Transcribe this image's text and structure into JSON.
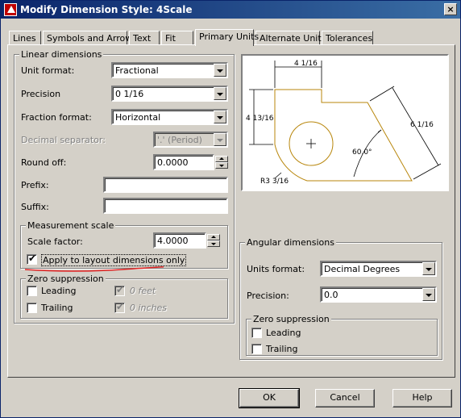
{
  "window": {
    "title": "Modify Dimension Style: 4Scale",
    "close_label": "×"
  },
  "tabs": [
    {
      "label": "Lines"
    },
    {
      "label": "Symbols and Arrows"
    },
    {
      "label": "Text"
    },
    {
      "label": "Fit"
    },
    {
      "label": "Primary Units"
    },
    {
      "label": "Alternate Units"
    },
    {
      "label": "Tolerances"
    }
  ],
  "active_tab": "Primary Units",
  "linear": {
    "group_title": "Linear dimensions",
    "unit_format_label": "Unit format:",
    "unit_format_value": "Fractional",
    "precision_label": "Precision",
    "precision_value": "0 1/16",
    "fraction_format_label": "Fraction format:",
    "fraction_format_value": "Horizontal",
    "decimal_sep_label": "Decimal separator:",
    "decimal_sep_value": "'.' (Period)",
    "round_off_label": "Round off:",
    "round_off_value": "0.0000",
    "prefix_label": "Prefix:",
    "prefix_value": "",
    "suffix_label": "Suffix:",
    "suffix_value": ""
  },
  "measurement": {
    "group_title": "Measurement scale",
    "scale_factor_label": "Scale factor:",
    "scale_factor_value": "4.0000",
    "apply_layout_label": "Apply to layout dimensions only",
    "apply_layout_checked": true
  },
  "zero_linear": {
    "group_title": "Zero suppression",
    "leading_label": "Leading",
    "trailing_label": "Trailing",
    "feet_label": "0 feet",
    "inches_label": "0 inches"
  },
  "angular": {
    "group_title": "Angular dimensions",
    "units_format_label": "Units format:",
    "units_format_value": "Decimal Degrees",
    "precision_label": "Precision:",
    "precision_value": "0.0"
  },
  "zero_angular": {
    "group_title": "Zero suppression",
    "leading_label": "Leading",
    "trailing_label": "Trailing"
  },
  "preview": {
    "dim_top": "4 1/16",
    "dim_left": "4 13/16",
    "dim_right": "6 1/16",
    "dim_angle": "60.0°",
    "dim_radius": "R3 3/16"
  },
  "buttons": {
    "ok": "OK",
    "cancel": "Cancel",
    "help": "Help"
  },
  "colors": {
    "annotation_underline": "#e02020",
    "preview_geometry": "#b8860b"
  },
  "icons": {
    "app": "autocad-icon",
    "close": "close-icon",
    "dropdown": "chevron-down-icon",
    "checkmark": "checkmark-icon"
  }
}
